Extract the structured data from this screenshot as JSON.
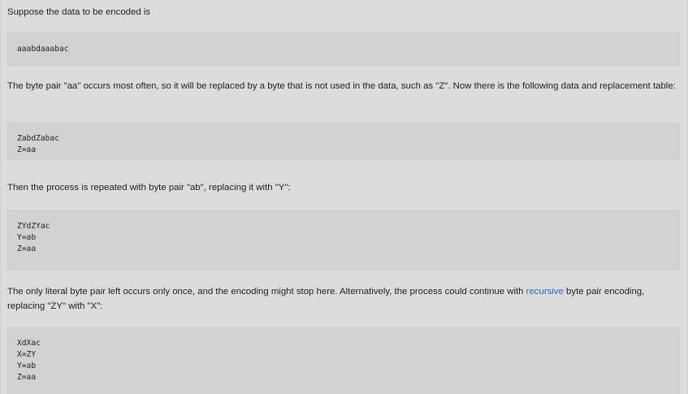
{
  "article": {
    "intro": "Suppose the data to be encoded is",
    "block1": [
      "aaabdaaabac"
    ],
    "para2": "The byte pair \"aa\" occurs most often, so it will be replaced by a byte that is not used in the data, such as \"Z\". Now there is the following data and replacement table:",
    "block2": [
      "ZabdZabac",
      "Z=aa"
    ],
    "para3": "Then the process is repeated with byte pair \"ab\", replacing it with \"Y\":",
    "block3": [
      "ZYdZYac",
      "Y=ab",
      "Z=aa"
    ],
    "para4": {
      "before": "The only literal byte pair left occurs only once, and the encoding might stop here. Alternatively, the process could continue with ",
      "link": "recursive",
      "after": " byte pair encoding, replacing \"ZY\" with \"X\":"
    },
    "block4": [
      "XdXac",
      "X=ZY",
      "Y=ab",
      "Z=aa"
    ]
  }
}
